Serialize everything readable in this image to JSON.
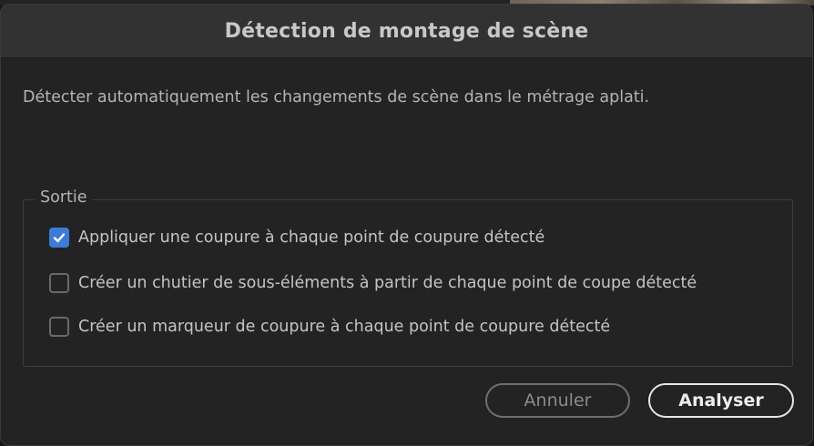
{
  "dialog": {
    "title": "Détection de montage de scène",
    "description": "Détecter automatiquement les changements de scène dans le métrage aplati."
  },
  "output_group": {
    "legend": "Sortie",
    "options": [
      {
        "label": "Appliquer une coupure à chaque point de coupure détecté",
        "checked": true
      },
      {
        "label": "Créer un chutier de sous-éléments à partir de chaque point de coupe détecté",
        "checked": false
      },
      {
        "label": "Créer un marqueur de coupure à chaque point de coupure détecté",
        "checked": false
      }
    ]
  },
  "buttons": {
    "cancel_label": "Annuler",
    "analyze_label": "Analyser"
  },
  "colors": {
    "accent": "#3d7bd9",
    "background": "#232323",
    "titlebar": "#323232"
  }
}
